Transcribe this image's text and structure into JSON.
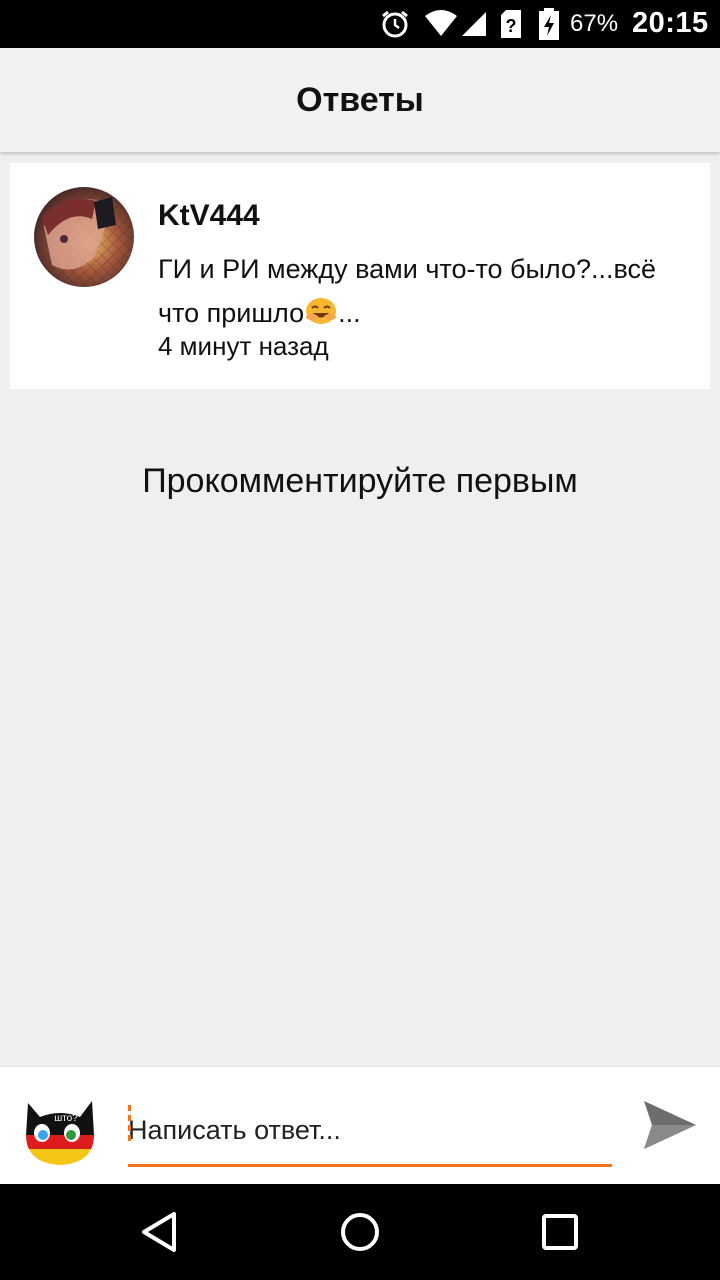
{
  "status_bar": {
    "icons": [
      "alarm-icon",
      "wifi-icon",
      "signal-icon",
      "sim-unknown-icon",
      "battery-charging-icon"
    ],
    "battery": "67%",
    "time": "20:15"
  },
  "app_bar": {
    "title": "Ответы"
  },
  "comment": {
    "username": "KtV444",
    "text_line1": "ГИ и РИ между вами что-то было?...всё",
    "text_line2_before": "что пришло",
    "emoji": "smiling-face-emoji",
    "text_line2_after": "...",
    "time": "4 минут назад"
  },
  "empty_state": {
    "message": "Прокомментируйте первым"
  },
  "reply": {
    "placeholder": "Написать ответ...",
    "value": ""
  },
  "nav": {
    "icons": [
      "back-icon",
      "home-icon",
      "recents-icon"
    ]
  },
  "colors": {
    "accent": "#f0731e",
    "background": "#efeef1",
    "app_bar": "#f1f1f3"
  }
}
